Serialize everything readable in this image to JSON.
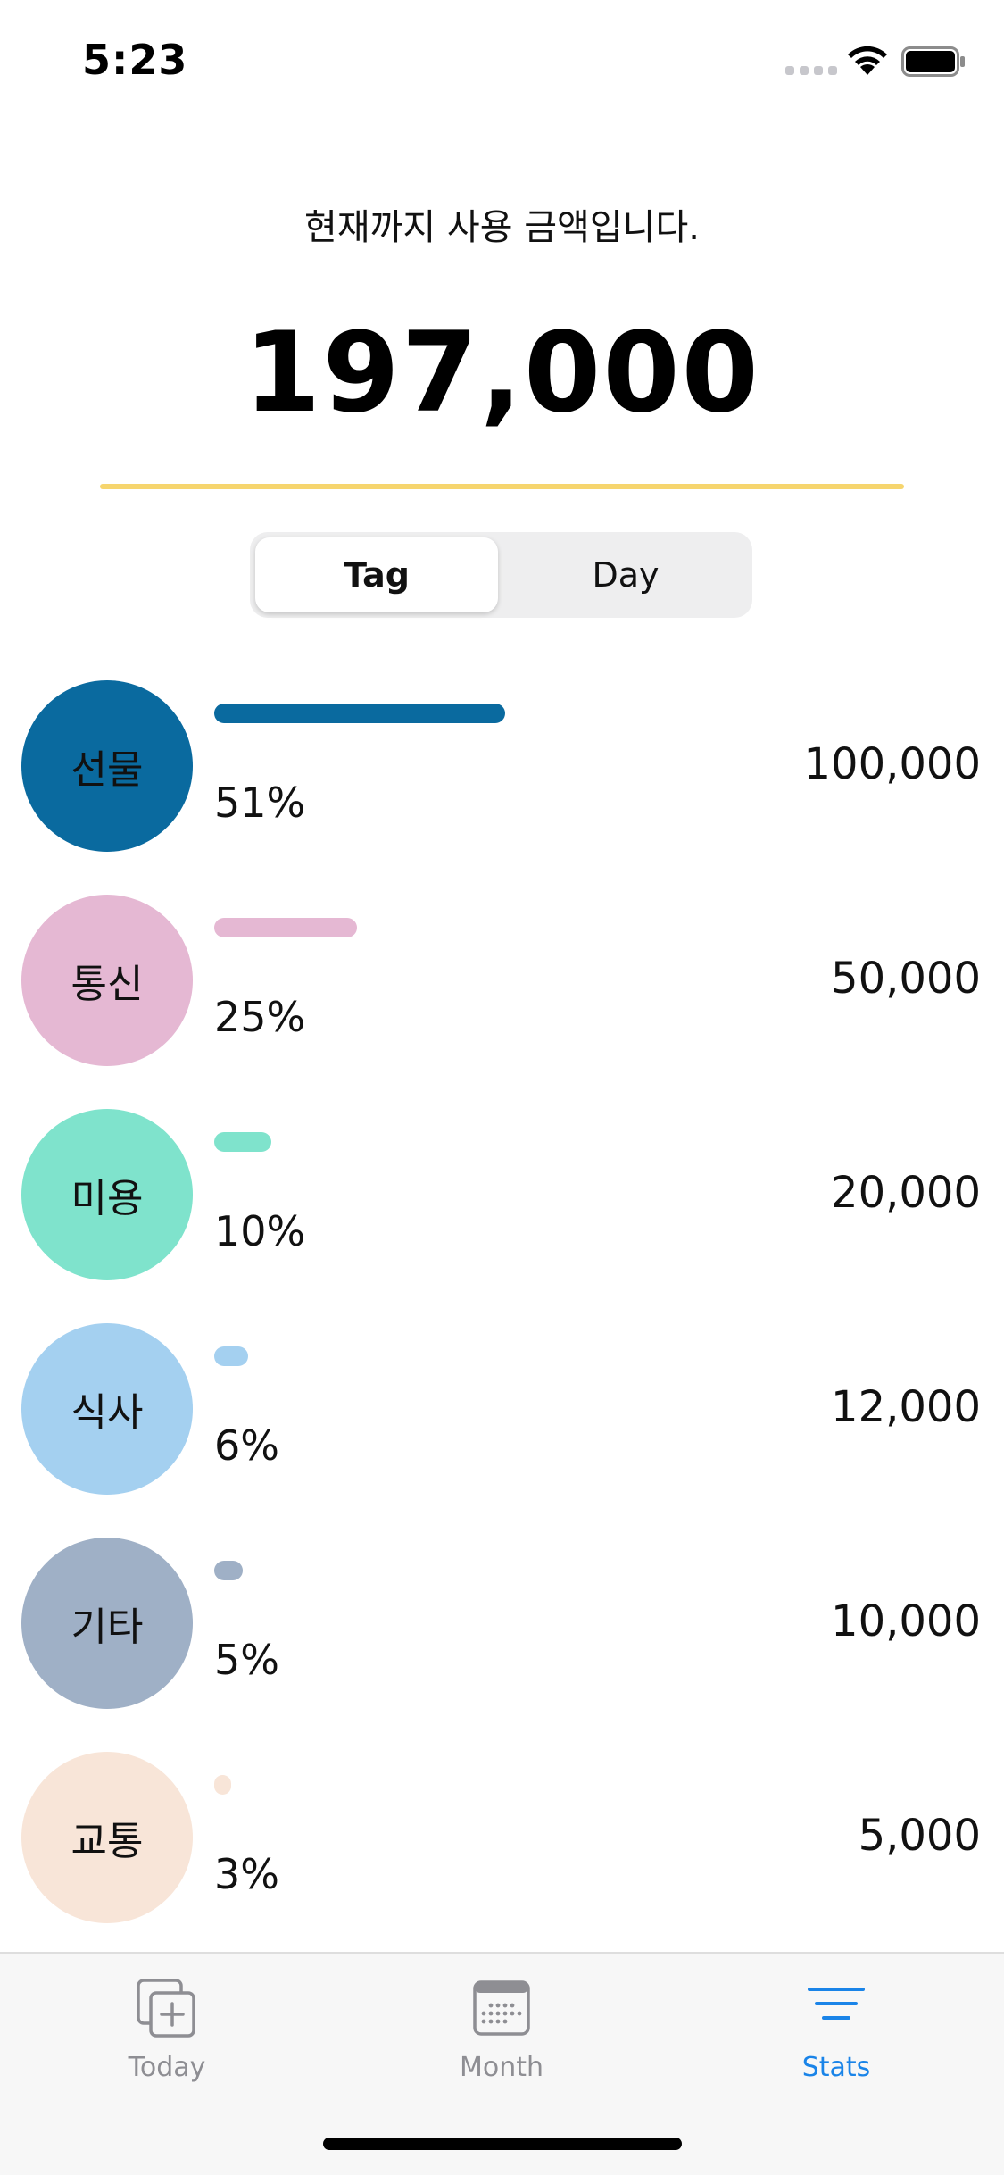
{
  "status_bar": {
    "time": "5:23"
  },
  "header": {
    "subtitle": "현재까지 사용 금액입니다.",
    "total": "197,000",
    "divider_color": "#f6d56e"
  },
  "segmented": {
    "options": [
      "Tag",
      "Day"
    ],
    "selected": "Tag"
  },
  "items": [
    {
      "tag": "선물",
      "percent_label": "51%",
      "percent": 51,
      "amount": "100,000",
      "color": "#0a6a9f"
    },
    {
      "tag": "통신",
      "percent_label": "25%",
      "percent": 25,
      "amount": "50,000",
      "color": "#e5b8d3"
    },
    {
      "tag": "미용",
      "percent_label": "10%",
      "percent": 10,
      "amount": "20,000",
      "color": "#7fe3cc"
    },
    {
      "tag": "식사",
      "percent_label": "6%",
      "percent": 6,
      "amount": "12,000",
      "color": "#a4d0f0"
    },
    {
      "tag": "기타",
      "percent_label": "5%",
      "percent": 5,
      "amount": "10,000",
      "color": "#9fb0c6"
    },
    {
      "tag": "교통",
      "percent_label": "3%",
      "percent": 3,
      "amount": "5,000",
      "color": "#f8e5d8"
    }
  ],
  "tab_bar": {
    "tabs": [
      {
        "label": "Today",
        "icon": "add-square-icon"
      },
      {
        "label": "Month",
        "icon": "calendar-icon"
      },
      {
        "label": "Stats",
        "icon": "stats-lines-icon"
      }
    ],
    "active": "Stats",
    "active_color": "#1a84e8",
    "inactive_color": "#8e8e93"
  }
}
